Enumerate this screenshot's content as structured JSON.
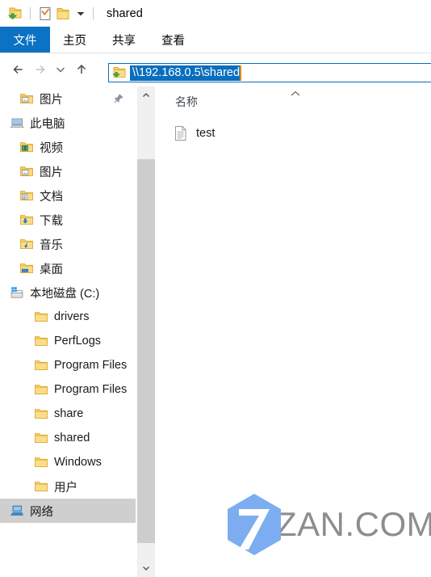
{
  "window": {
    "title": "shared",
    "quick_access": {
      "explorer_icon": "folder-download-icon",
      "properties_icon": "properties-checkbox-icon",
      "new_folder_icon": "folder-icon",
      "customize_icon": "chevron-down-icon"
    }
  },
  "ribbon": {
    "tabs": [
      {
        "label": "文件",
        "active": true
      },
      {
        "label": "主页",
        "active": false
      },
      {
        "label": "共享",
        "active": false
      },
      {
        "label": "查看",
        "active": false
      }
    ]
  },
  "navbar": {
    "back_icon": "arrow-left-icon",
    "forward_icon": "arrow-right-icon",
    "recent_icon": "chevron-down-icon",
    "up_icon": "arrow-up-icon",
    "address": {
      "icon": "folder-download-icon",
      "value": "\\\\192.168.0.5\\shared",
      "placeholder": "\\\\192.168.0.5\\shared",
      "selected": true,
      "selection_color": "#0a6ebd",
      "border_color": "#0a6ebd",
      "caret_color": "#e8821a"
    }
  },
  "sidebar": {
    "items": [
      {
        "label": "图片",
        "icon": "folder-pictures-icon",
        "indent": 1,
        "pinned": true,
        "selected": false
      },
      {
        "label": "此电脑",
        "icon": "this-pc-icon",
        "indent": 0,
        "pinned": false,
        "selected": false
      },
      {
        "label": "视频",
        "icon": "folder-videos-icon",
        "indent": 1,
        "pinned": false,
        "selected": false
      },
      {
        "label": "图片",
        "icon": "folder-pictures-icon",
        "indent": 1,
        "pinned": false,
        "selected": false
      },
      {
        "label": "文档",
        "icon": "folder-documents-icon",
        "indent": 1,
        "pinned": false,
        "selected": false
      },
      {
        "label": "下载",
        "icon": "folder-downloads-icon",
        "indent": 1,
        "pinned": false,
        "selected": false
      },
      {
        "label": "音乐",
        "icon": "folder-music-icon",
        "indent": 1,
        "pinned": false,
        "selected": false
      },
      {
        "label": "桌面",
        "icon": "folder-desktop-icon",
        "indent": 1,
        "pinned": false,
        "selected": false
      },
      {
        "label": "本地磁盘 (C:)",
        "icon": "local-disk-icon",
        "indent": 0,
        "pinned": false,
        "selected": false
      },
      {
        "label": "drivers",
        "icon": "folder-icon",
        "indent": 2,
        "pinned": false,
        "selected": false
      },
      {
        "label": "PerfLogs",
        "icon": "folder-icon",
        "indent": 2,
        "pinned": false,
        "selected": false
      },
      {
        "label": "Program Files",
        "icon": "folder-icon",
        "indent": 2,
        "pinned": false,
        "selected": false
      },
      {
        "label": "Program Files",
        "icon": "folder-icon",
        "indent": 2,
        "pinned": false,
        "selected": false
      },
      {
        "label": "share",
        "icon": "folder-icon",
        "indent": 2,
        "pinned": false,
        "selected": false
      },
      {
        "label": "shared",
        "icon": "folder-icon",
        "indent": 2,
        "pinned": false,
        "selected": false
      },
      {
        "label": "Windows",
        "icon": "folder-icon",
        "indent": 2,
        "pinned": false,
        "selected": false
      },
      {
        "label": "用户",
        "icon": "folder-icon",
        "indent": 2,
        "pinned": false,
        "selected": false
      },
      {
        "label": "网络",
        "icon": "network-icon",
        "indent": 0,
        "pinned": false,
        "selected": true
      }
    ],
    "scrollbar": {
      "up_icon": "chevron-up-icon",
      "down_icon": "chevron-down-icon",
      "thumb_color": "#cdcdcd",
      "track_color": "#f0f0f0"
    }
  },
  "file_list": {
    "columns": [
      {
        "label": "名称",
        "sort": "ascending",
        "sort_icon": "chevron-up-icon"
      }
    ],
    "rows": [
      {
        "name": "test",
        "icon": "text-document-icon"
      }
    ]
  },
  "watermark": {
    "text": "ZAN.COM",
    "digit": "7",
    "hex_color": "#7badf0",
    "text_color": "#8d8d8d"
  }
}
